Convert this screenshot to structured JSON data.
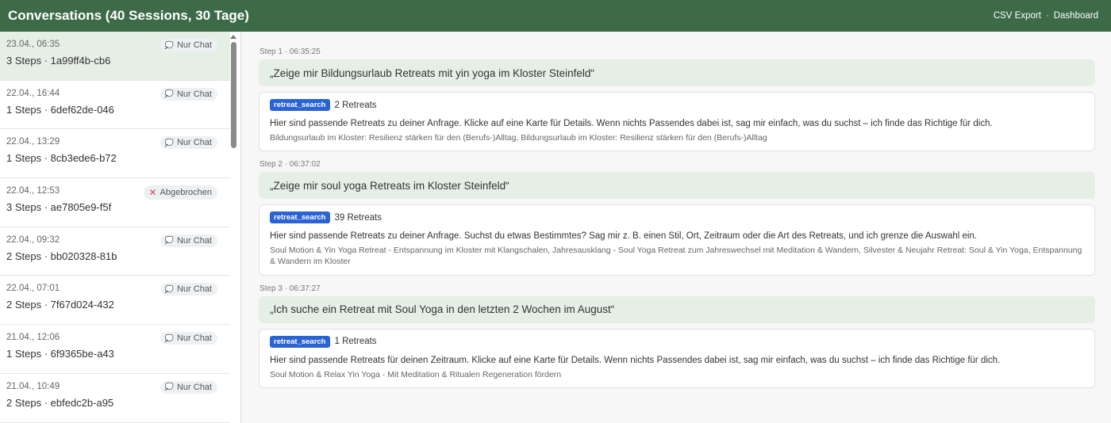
{
  "header": {
    "title": "Conversations (40 Sessions, 30 Tage)",
    "csv_export": "CSV Export",
    "separator": "·",
    "dashboard": "Dashboard"
  },
  "sessions": [
    {
      "date": "23.04., 06:35",
      "meta": "3 Steps · 1a99ff4b-cb6",
      "badge": "Nur Chat",
      "badge_icon": "chat-bubble-icon"
    },
    {
      "date": "22.04., 16:44",
      "meta": "1 Steps · 6def62de-046",
      "badge": "Nur Chat",
      "badge_icon": "chat-bubble-icon"
    },
    {
      "date": "22.04., 13:29",
      "meta": "1 Steps · 8cb3ede6-b72",
      "badge": "Nur Chat",
      "badge_icon": "chat-bubble-icon"
    },
    {
      "date": "22.04., 12:53",
      "meta": "3 Steps · ae7805e9-f5f",
      "badge": "Abgebrochen",
      "badge_icon": "cross-icon"
    },
    {
      "date": "22.04., 09:32",
      "meta": "2 Steps · bb020328-81b",
      "badge": "Nur Chat",
      "badge_icon": "chat-bubble-icon"
    },
    {
      "date": "22.04., 07:01",
      "meta": "2 Steps · 7f67d024-432",
      "badge": "Nur Chat",
      "badge_icon": "chat-bubble-icon"
    },
    {
      "date": "21.04., 12:06",
      "meta": "1 Steps · 6f9365be-a43",
      "badge": "Nur Chat",
      "badge_icon": "chat-bubble-icon"
    },
    {
      "date": "21.04., 10:49",
      "meta": "2 Steps · ebfedc2b-a95",
      "badge": "Nur Chat",
      "badge_icon": "chat-bubble-icon"
    }
  ],
  "steps": [
    {
      "label": "Step 1 · 06:35:25",
      "query": "„Zeige mir Bildungsurlaub Retreats mit yin yoga im Kloster Steinfeld“",
      "tool": "retreat_search",
      "count": "2 Retreats",
      "text": "Hier sind passende Retreats zu deiner Anfrage. Klicke auf eine Karte für Details. Wenn nichts Passendes dabei ist, sag mir einfach, was du suchst – ich finde das Richtige für dich.",
      "titles": "Bildungsurlaub im Kloster: Resilienz stärken für den (Berufs-)Alltag, Bildungsurlaub im Kloster: Resilienz stärken für den (Berufs-)Alltag"
    },
    {
      "label": "Step 2 · 06:37:02",
      "query": "„Zeige mir soul yoga Retreats im Kloster Steinfeld“",
      "tool": "retreat_search",
      "count": "39 Retreats",
      "text": "Hier sind passende Retreats zu deiner Anfrage. Suchst du etwas Bestimmtes? Sag mir z. B. einen Stil, Ort, Zeitraum oder die Art des Retreats, und ich grenze die Auswahl ein.",
      "titles": "Soul Motion & Yin Yoga Retreat - Entspannung im Kloster mit Klangschalen, Jahresausklang - Soul Yoga Retreat zum Jahreswechsel mit Meditation & Wandern, Silvester & Neujahr Retreat: Soul & Yin Yoga, Entspannung & Wandern im Kloster"
    },
    {
      "label": "Step 3 · 06:37:27",
      "query": "„Ich suche ein Retreat mit Soul Yoga in den letzten 2 Wochen im August“",
      "tool": "retreat_search",
      "count": "1 Retreats",
      "text": "Hier sind passende Retreats für deinen Zeitraum. Klicke auf eine Karte für Details. Wenn nichts Passendes dabei ist, sag mir einfach, was du suchst – ich finde das Richtige für dich.",
      "titles": "Soul Motion & Relax Yin Yoga - Mit Meditation & Ritualen Regeneration fördern"
    }
  ],
  "colors": {
    "header_bg": "#3d6b47",
    "active_session_bg": "#e6efe6",
    "tool_badge_bg": "#2a63d4",
    "aborted_icon": "#e0455a"
  }
}
